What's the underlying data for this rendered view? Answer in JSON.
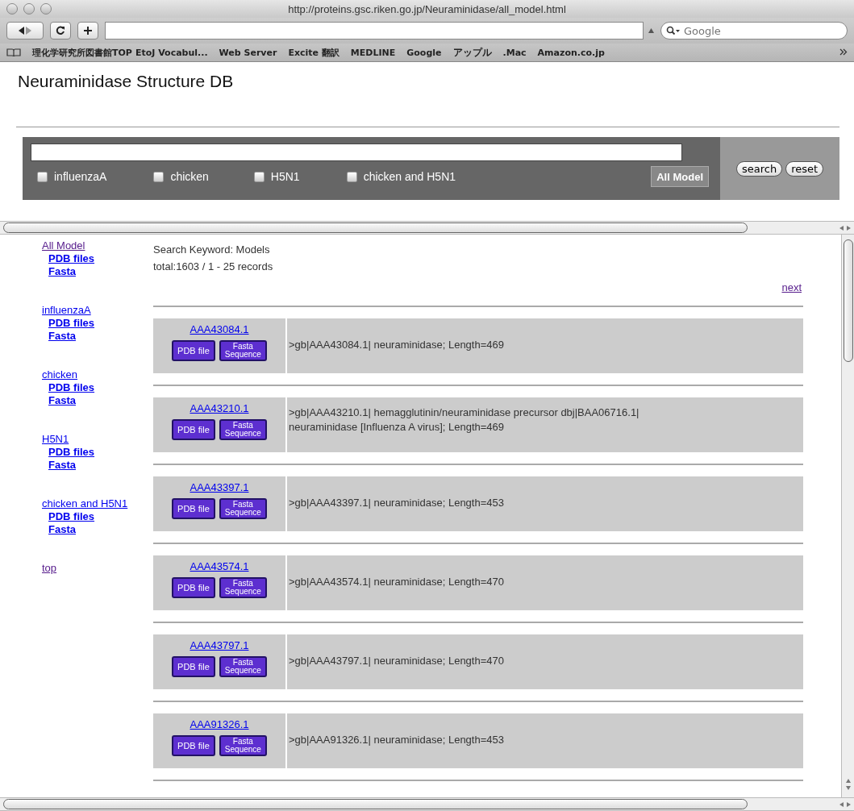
{
  "window": {
    "title": "http://proteins.gsc.riken.go.jp/Neuraminidase/all_model.html"
  },
  "toolbar": {
    "search_placeholder": "Google"
  },
  "bookmarks": [
    "理化学研究所図書館TOP",
    "EtoJ Vocabul...",
    "Web Server",
    "Excite 翻訳",
    "MEDLINE",
    "Google",
    "アップル",
    ".Mac",
    "Amazon.co.jp"
  ],
  "page": {
    "heading": "Neuraminidase Structure DB",
    "search_panel": {
      "filters": [
        {
          "label": "influenzaA",
          "checked": false
        },
        {
          "label": "chicken",
          "checked": false
        },
        {
          "label": "H5N1",
          "checked": false
        },
        {
          "label": "chicken and H5N1",
          "checked": false
        }
      ],
      "all_button": "All Model",
      "buttons": [
        "search",
        "reset"
      ]
    },
    "sidebar": [
      {
        "label": "All Model",
        "visited": true,
        "children": [
          {
            "label": "PDB files",
            "visited": false
          },
          {
            "label": "Fasta",
            "visited": false
          }
        ]
      },
      {
        "label": "influenzaA",
        "visited": false,
        "children": [
          {
            "label": "PDB files",
            "visited": false
          },
          {
            "label": "Fasta",
            "visited": false
          }
        ]
      },
      {
        "label": "chicken",
        "visited": false,
        "children": [
          {
            "label": "PDB files",
            "visited": false
          },
          {
            "label": "Fasta",
            "visited": false
          }
        ]
      },
      {
        "label": "H5N1",
        "visited": false,
        "children": [
          {
            "label": "PDB files",
            "visited": false
          },
          {
            "label": "Fasta",
            "visited": false
          }
        ]
      },
      {
        "label": "chicken and H5N1",
        "visited": false,
        "children": [
          {
            "label": "PDB files",
            "visited": false
          },
          {
            "label": "Fasta",
            "visited": false
          }
        ]
      },
      {
        "label": "top",
        "visited": true
      }
    ],
    "keyword": "Search Keyword: Models",
    "total": "total:1603 / 1 - 25 records",
    "next": {
      "label": "next",
      "visited": true
    },
    "records": [
      {
        "id": "AAA43084.1",
        "pdb_button": "PDB file",
        "fasta_button": [
          "Fasta",
          "Sequence"
        ],
        "lines": [
          ">gb|AAA43084.1| neuraminidase; Length=469"
        ]
      },
      {
        "id": "AAA43210.1",
        "pdb_button": "PDB file",
        "fasta_button": [
          "Fasta",
          "Sequence"
        ],
        "lines": [
          ">gb|AAA43210.1| hemagglutinin/neuraminidase precursor dbj|BAA06716.1|",
          "neuraminidase [Influenza A virus]; Length=469"
        ]
      },
      {
        "id": "AAA43397.1",
        "pdb_button": "PDB file",
        "fasta_button": [
          "Fasta",
          "Sequence"
        ],
        "lines": [
          ">gb|AAA43397.1| neuraminidase; Length=453"
        ]
      },
      {
        "id": "AAA43574.1",
        "pdb_button": "PDB file",
        "fasta_button": [
          "Fasta",
          "Sequence"
        ],
        "lines": [
          ">gb|AAA43574.1| neuraminidase; Length=470"
        ]
      },
      {
        "id": "AAA43797.1",
        "pdb_button": "PDB file",
        "fasta_button": [
          "Fasta",
          "Sequence"
        ],
        "lines": [
          ">gb|AAA43797.1| neuraminidase; Length=470"
        ]
      },
      {
        "id": "AAA91326.1",
        "pdb_button": "PDB file",
        "fasta_button": [
          "Fasta",
          "Sequence"
        ],
        "lines": [
          ">gb|AAA91326.1| neuraminidase; Length=453"
        ]
      }
    ]
  }
}
